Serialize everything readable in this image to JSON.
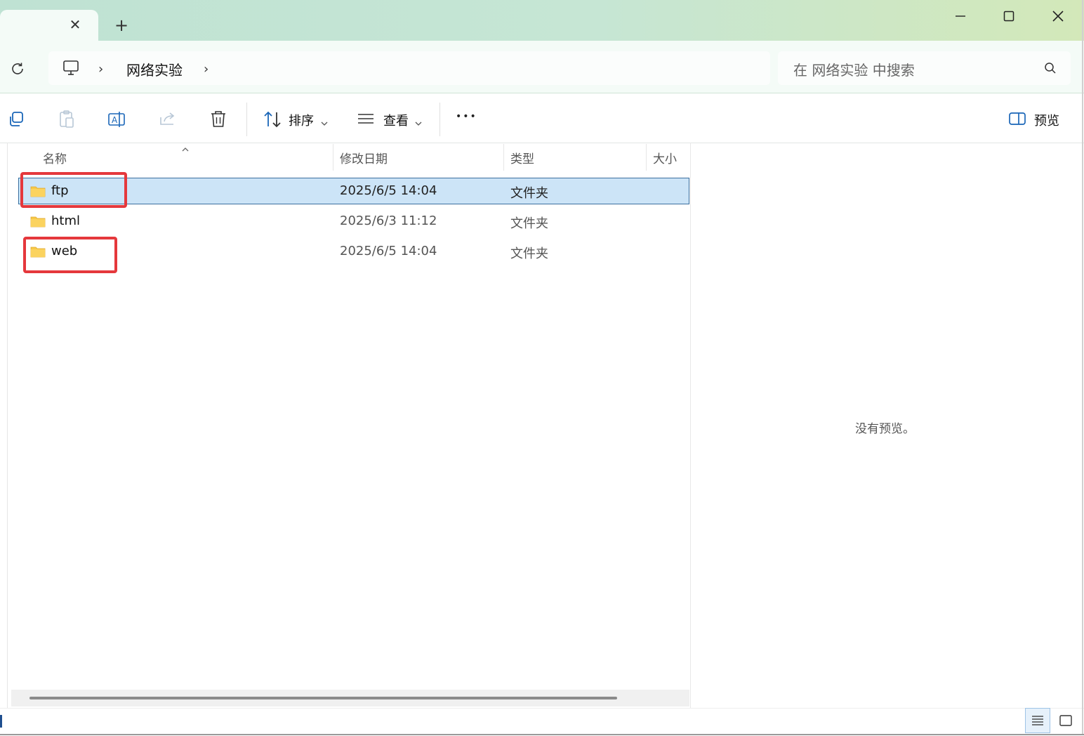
{
  "window": {
    "tab_close_glyph": "✕",
    "new_tab_glyph": "+",
    "controls": [
      "minimize-icon",
      "maximize-icon",
      "close-icon"
    ]
  },
  "address": {
    "breadcrumb": "网络实验",
    "chevron": "›"
  },
  "search": {
    "placeholder": "在 网络实验 中搜索"
  },
  "toolbar": {
    "sort_label": "排序",
    "view_label": "查看",
    "more_glyph": "•••",
    "preview_label": "预览"
  },
  "columns": {
    "name": "名称",
    "date": "修改日期",
    "type": "类型",
    "size": "大小"
  },
  "files": [
    {
      "name": "ftp",
      "date": "2025/6/5 14:04",
      "type": "文件夹",
      "selected": true
    },
    {
      "name": "html",
      "date": "2025/6/3 11:12",
      "type": "文件夹",
      "selected": false
    },
    {
      "name": "web",
      "date": "2025/6/5 14:04",
      "type": "文件夹",
      "selected": false
    }
  ],
  "preview": {
    "empty_text": "没有预览。"
  },
  "colors": {
    "selection": "#cce4f7",
    "highlight_box": "#e5383c",
    "folder": "#f7c948"
  }
}
